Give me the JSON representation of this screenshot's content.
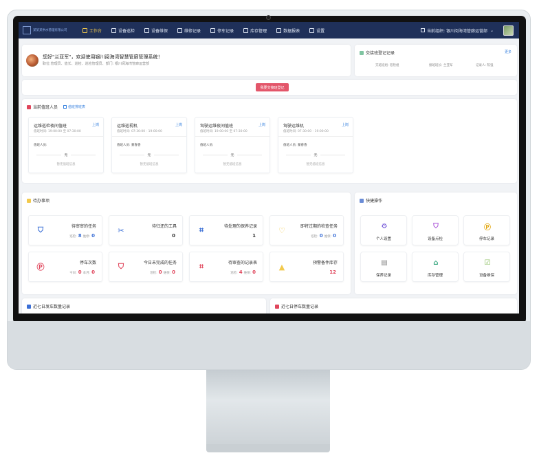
{
  "header": {
    "logo_text": "某某某供水管理有限公司",
    "nav": [
      {
        "label": "工作台",
        "icon": "monitor-icon",
        "active": true
      },
      {
        "label": "设备巡检",
        "icon": "inspection-icon"
      },
      {
        "label": "设备维保",
        "icon": "wrench-icon"
      },
      {
        "label": "维修记录",
        "icon": "record-icon"
      },
      {
        "label": "停车记录",
        "icon": "parking-icon"
      },
      {
        "label": "库存管理",
        "icon": "inventory-icon"
      },
      {
        "label": "数据报表",
        "icon": "report-icon"
      },
      {
        "label": "设置",
        "icon": "gear-icon"
      }
    ],
    "org_label": "当前组织: 银川阅海湾管廊运营部",
    "org_caret": "⌄"
  },
  "welcome": {
    "title": "您好\"兰亚军\"，欢迎使用银川阅海湾智慧管廊管理系统！",
    "subtitle": "职位:管理员、值长、巡检、巡检管理员、部门: 银川阅海湾管廊运营部"
  },
  "shift_panel": {
    "title": "交接班登记记录",
    "more": "更多",
    "fields": [
      "交班班组: 巡检组",
      "接班班长: 兰亚军",
      "记录人: 陈强"
    ]
  },
  "switch_button": "我要交接班登记",
  "duty": {
    "title": "当前值班人员",
    "hint": "值班排班表",
    "cards": [
      {
        "name": "运维巡检夜间值班",
        "up": "上岗",
        "time": "值班时间: 19:00:00 至 07:30:00",
        "person": "值班人员:",
        "none": "无",
        "empty": "暂无值班信息"
      },
      {
        "name": "运维巡视机",
        "up": "上岗",
        "time": "值班时间: 07:30:00 - 19:00:00",
        "person": "值班人员: 蒙春香",
        "none": "无",
        "empty": "暂无值班信息"
      },
      {
        "name": "驾驶运维夜间值班",
        "up": "上岗",
        "time": "值班时间: 19:00:00 至 07:30:00",
        "person": "值班人员:",
        "none": "无",
        "empty": "暂无值班信息"
      },
      {
        "name": "驾驶运维机",
        "up": "上岗",
        "time": "值班时间: 07:30:00 - 19:00:00",
        "person": "值班人员: 蒙春香",
        "none": "无",
        "empty": "暂无值班信息"
      }
    ]
  },
  "todo": {
    "title": "待办事项",
    "items": [
      {
        "label": "待审审的任务",
        "icon": "shield-icon",
        "color": "#3b6fd6",
        "text_a": "巡检:",
        "num_a": "8",
        "text_b": "维修:",
        "num_b": "0"
      },
      {
        "label": "待归还的工具",
        "icon": "tools-icon",
        "color": "#3b6fd6",
        "text_a": "",
        "num_a": "",
        "text_b": "",
        "num_b": "0"
      },
      {
        "label": "待处理的保养记录",
        "icon": "scan-icon",
        "color": "#3b6fd6",
        "text_a": "",
        "num_a": "",
        "text_b": "",
        "num_b": "1"
      },
      {
        "label": "即将过期的检查任务",
        "icon": "heart-badge-icon",
        "color": "#f2c94c",
        "text_a": "巡检:",
        "num_a": "0",
        "text_b": "维保:",
        "num_b": "0"
      },
      {
        "label": "停车次数",
        "icon": "parking-icon",
        "color": "#e0455b",
        "text_a": "今日:",
        "num_a": "0",
        "text_b": "本月:",
        "num_b": "0"
      },
      {
        "label": "今日未完成的任务",
        "icon": "shield-search-icon",
        "color": "#e0455b",
        "text_a": "巡检:",
        "num_a": "0",
        "text_b": "维保:",
        "num_b": "0"
      },
      {
        "label": "待审查的记录表",
        "icon": "scan-red-icon",
        "color": "#e0455b",
        "text_a": "巡检:",
        "num_a": "4",
        "text_b": "维保:",
        "num_b": "0"
      },
      {
        "label": "预警备件库存",
        "icon": "warning-icon",
        "color": "#f2c94c",
        "text_a": "",
        "num_a": "",
        "text_b": "",
        "num_b": "12"
      }
    ]
  },
  "quick": {
    "title": "快捷操作",
    "items": [
      {
        "label": "个人设置",
        "icon": "gear-icon",
        "color": "#6a4bd6"
      },
      {
        "label": "设备点检",
        "icon": "shield-search-icon",
        "color": "#a64bd6"
      },
      {
        "label": "停车记录",
        "icon": "parking-icon",
        "color": "#e2a60e"
      },
      {
        "label": "保养记录",
        "icon": "clipboard-icon",
        "color": "#888888"
      },
      {
        "label": "库存管理",
        "icon": "warehouse-icon",
        "color": "#2fa37a"
      },
      {
        "label": "设备维保",
        "icon": "checklist-icon",
        "color": "#7ab648"
      }
    ]
  },
  "bottom": {
    "left_title": "近七日发车数量记录",
    "right_title": "近七日停车数量记录"
  },
  "colors": {
    "topbar": "#1f3059",
    "accent_red": "#e3566a",
    "accent_blue": "#3b6fd6"
  }
}
